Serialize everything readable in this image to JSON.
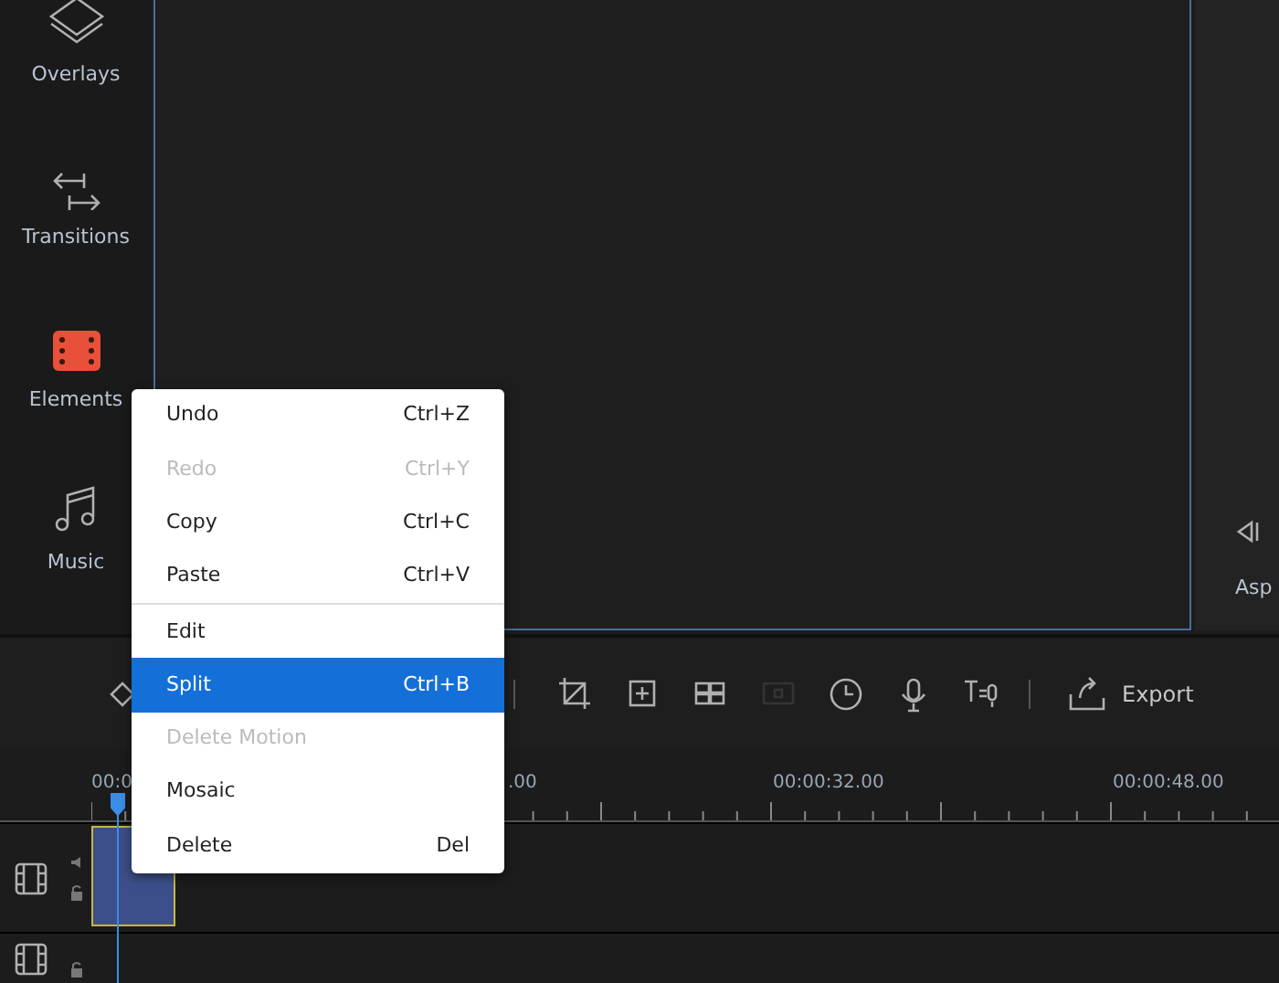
{
  "sidebar": {
    "items": [
      {
        "label": "Overlays"
      },
      {
        "label": "Transitions"
      },
      {
        "label": "Elements"
      },
      {
        "label": "Music"
      }
    ]
  },
  "right_panel": {
    "label": "Asp"
  },
  "toolbar": {
    "buttons": [
      {
        "disabled": false
      },
      {
        "disabled": false
      },
      {
        "disabled": false
      },
      {
        "disabled": true
      },
      {
        "disabled": false
      },
      {
        "disabled": false
      },
      {
        "disabled": false
      }
    ],
    "export": "Export"
  },
  "timeline": {
    "ruler_labels": [
      "00:0",
      ".00",
      "00:00:32.00",
      "00:00:48.00"
    ]
  },
  "context_menu": {
    "groups": [
      [
        {
          "label": "Undo",
          "shortcut": "Ctrl+Z",
          "disabled": false,
          "selected": false
        },
        {
          "label": "Redo",
          "shortcut": "Ctrl+Y",
          "disabled": true,
          "selected": false
        },
        {
          "label": "Copy",
          "shortcut": "Ctrl+C",
          "disabled": false,
          "selected": false
        },
        {
          "label": "Paste",
          "shortcut": "Ctrl+V",
          "disabled": false,
          "selected": false
        }
      ],
      [
        {
          "label": "Edit",
          "disabled": false,
          "selected": false
        },
        {
          "label": "Split",
          "shortcut": "Ctrl+B",
          "disabled": false,
          "selected": true
        },
        {
          "label": "Delete Motion",
          "disabled": true,
          "selected": false
        },
        {
          "label": "Mosaic",
          "disabled": false,
          "selected": false
        },
        {
          "label": "Delete",
          "shortcut": "Del",
          "disabled": false,
          "selected": false
        }
      ]
    ]
  }
}
